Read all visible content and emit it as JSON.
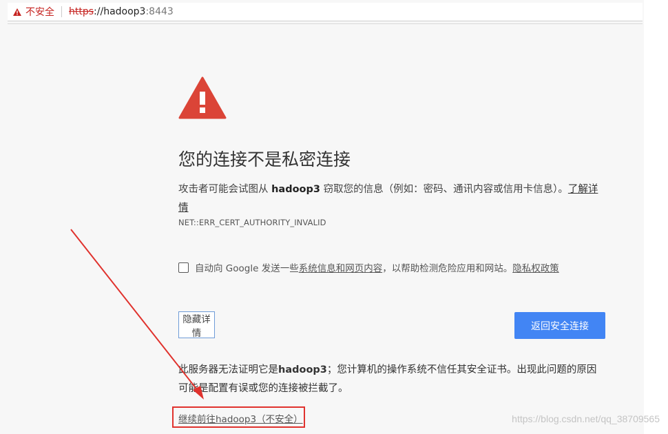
{
  "addressbar": {
    "security_label": "不安全",
    "url_protocol": "https",
    "url_sep": "://",
    "url_host": "hadoop3",
    "url_port": ":8443"
  },
  "interstitial": {
    "heading": "您的连接不是私密连接",
    "main_text_before": "攻击者可能会试图从 ",
    "main_host": "hadoop3",
    "main_text_after": " 窃取您的信息（例如：密码、通讯内容或信用卡信息）。",
    "learn_more": "了解详情",
    "error_code": "NET::ERR_CERT_AUTHORITY_INVALID",
    "optin_prefix": "自动向 Google 发送一些",
    "optin_link1": "系统信息和网页内容",
    "optin_middle": "，以帮助检测危险应用和网站。",
    "optin_link2": "隐私权政策",
    "details_button": "隐藏详情",
    "back_button": "返回安全连接",
    "detail_before": "此服务器无法证明它是",
    "detail_host": "hadoop3",
    "detail_after": "；您计算机的操作系统不信任其安全证书。出现此问题的原因可能是配置有误或您的连接被拦截了。",
    "proceed_link": "继续前往hadoop3（不安全）"
  },
  "annotation": {
    "color": "#e0322d"
  },
  "watermark": "https://blog.csdn.net/qq_38709565",
  "colors": {
    "warning_red": "#db4437",
    "primary_blue": "#4285f4"
  }
}
